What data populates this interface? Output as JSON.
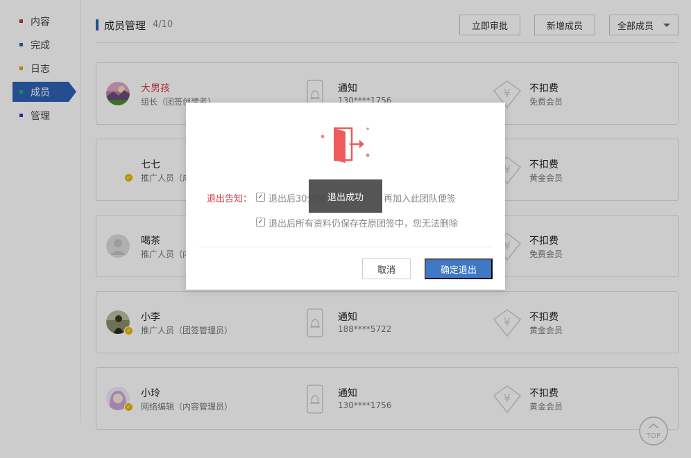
{
  "sidebar": {
    "items": [
      {
        "label": "内容",
        "color": "#c0392b",
        "active": false
      },
      {
        "label": "完成",
        "color": "#2f62b6",
        "active": false
      },
      {
        "label": "日志",
        "color": "#e0a800",
        "active": false
      },
      {
        "label": "成员",
        "color": "#22b573",
        "active": true
      },
      {
        "label": "管理",
        "color": "#2f3fb6",
        "active": false
      }
    ]
  },
  "header": {
    "title": "成员管理",
    "count": "4/10",
    "approve_label": "立即审批",
    "add_member_label": "新增成员",
    "filter_label": "全部成员"
  },
  "members": [
    {
      "name": "大男孩",
      "role": "组长（团签创建者）",
      "notify": "通知",
      "phone": "130****1756",
      "fee": "不扣费",
      "level": "免费会员",
      "icon": "avatar-landscape"
    },
    {
      "name": "七七",
      "role": "推广人员（成",
      "notify": "",
      "phone": "",
      "fee": "不扣费",
      "level": "黄金会员",
      "icon": "avatar-default"
    },
    {
      "name": "喝茶",
      "role": "推广人员（内",
      "notify": "",
      "phone": "",
      "fee": "不扣费",
      "level": "免费会员",
      "icon": "avatar-gray"
    },
    {
      "name": "小李",
      "role": "推广人员（团签管理员）",
      "notify": "通知",
      "phone": "188****5722",
      "fee": "不扣费",
      "level": "黄金会员",
      "icon": "avatar-person"
    },
    {
      "name": "小玲",
      "role": "网络编辑（内容管理员）",
      "notify": "通知",
      "phone": "130****1756",
      "fee": "不扣费",
      "level": "黄金会员",
      "icon": "avatar-girl"
    }
  ],
  "top_button": {
    "label": "TOP"
  },
  "modal": {
    "notice_label": "退出告知：",
    "notice_1": "退出后30分钟",
    "notice_1b": "再加入此团队便签",
    "notice_2": "退出后所有资料仍保存在原团签中，您无法删除",
    "cancel_label": "取消",
    "confirm_label": "确定退出"
  },
  "toast": {
    "text": "退出成功"
  }
}
